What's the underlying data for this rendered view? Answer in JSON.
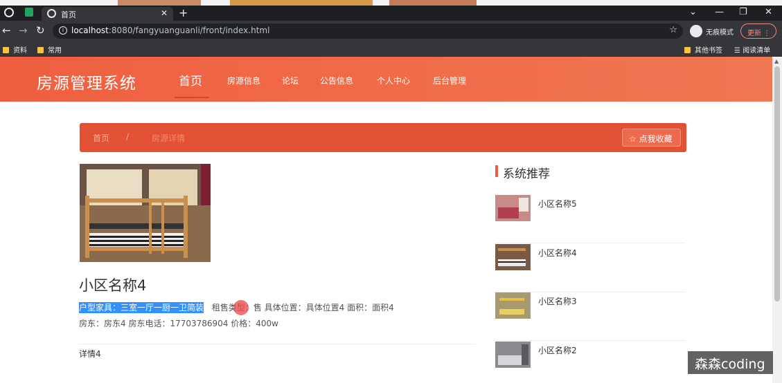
{
  "browser": {
    "tab_title": "首页",
    "tab_close": "✕",
    "new_tab": "+",
    "url_host": "localhost",
    "url_rest": ":8080/fangyuanguanli/front/index.html",
    "incognito_label": "无痕模式",
    "update_label": "更新",
    "window_controls": [
      "⌄",
      "—",
      "❐",
      "✕"
    ],
    "bookmarks_left": [
      "资料",
      "常用"
    ],
    "bookmarks_right": [
      "其他书签",
      "阅读清单"
    ]
  },
  "nav": {
    "brand": "房源管理系统",
    "items": [
      "首页",
      "房源信息",
      "论坛",
      "公告信息",
      "个人中心",
      "后台管理"
    ],
    "active_index": 0
  },
  "breadcrumb": {
    "home": "首页",
    "separator": "/",
    "current": "房源详情",
    "favorite_label": "☆ 点我收藏"
  },
  "detail": {
    "title": "小区名称4",
    "highlighted": "户型家具：三室一厅一厨一卫简装",
    "info_line1_rest": "租售类型：售 具体位置：具体位置4 面积：面积4",
    "info_line2": "房东：房东4 房东电话：17703786904 价格：400w",
    "description": "详情4"
  },
  "recommend": {
    "title": "系统推荐",
    "items": [
      {
        "name": "小区名称5"
      },
      {
        "name": "小区名称4"
      },
      {
        "name": "小区名称3"
      },
      {
        "name": "小区名称2"
      }
    ]
  },
  "watermark": "森森coding",
  "colors": {
    "nav_start": "#ef5f3f",
    "nav_end": "#f07852",
    "breadcrumb_bg": "#e35134",
    "selection": "#3390ff"
  },
  "icons": [
    "globe-icon",
    "info-icon",
    "star-icon",
    "folder-icon",
    "incognito-icon",
    "bunk-bed-photo"
  ]
}
